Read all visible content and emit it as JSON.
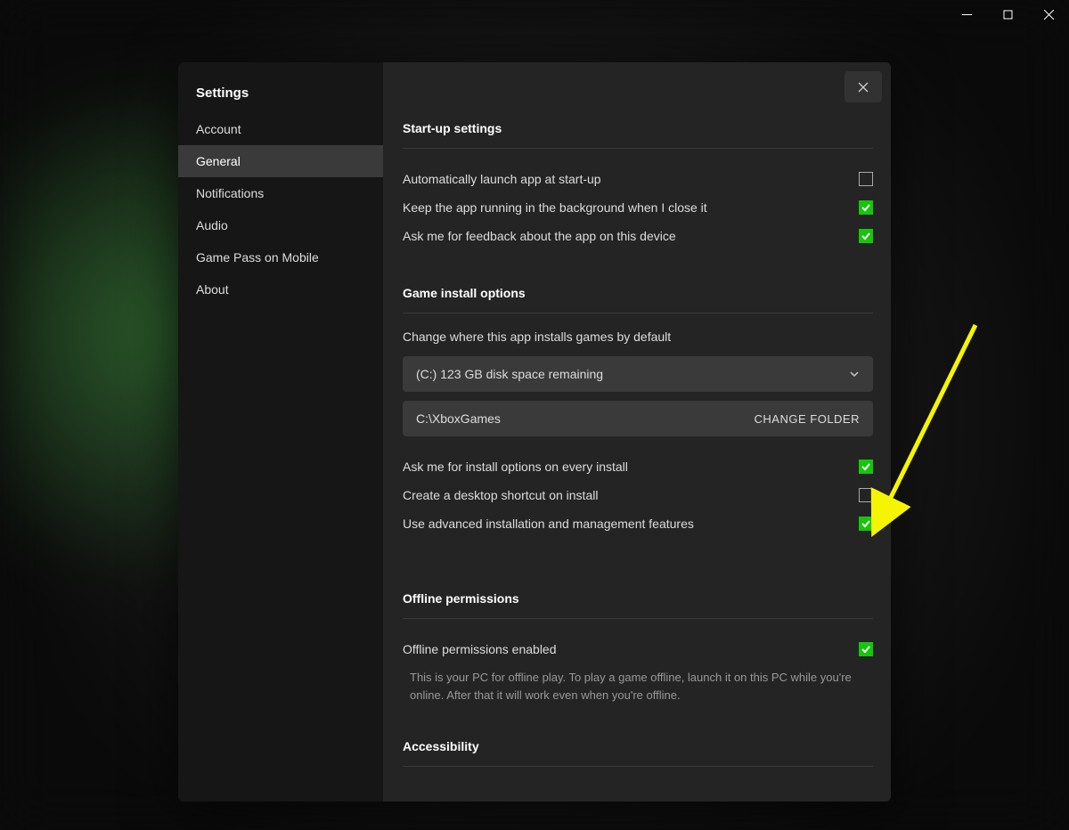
{
  "sidebar": {
    "title": "Settings",
    "items": [
      {
        "label": "Account"
      },
      {
        "label": "General"
      },
      {
        "label": "Notifications"
      },
      {
        "label": "Audio"
      },
      {
        "label": "Game Pass on Mobile"
      },
      {
        "label": "About"
      }
    ],
    "active_index": 1
  },
  "sections": {
    "startup": {
      "title": "Start-up settings",
      "items": [
        {
          "label": "Automatically launch app at start-up",
          "checked": false
        },
        {
          "label": "Keep the app running in the background when I close it",
          "checked": true
        },
        {
          "label": "Ask me for feedback about the app on this device",
          "checked": true
        }
      ]
    },
    "install": {
      "title": "Game install options",
      "where_label": "Change where this app installs games by default",
      "drive_selected": "(C:) 123 GB disk space remaining",
      "folder_path": "C:\\XboxGames",
      "change_folder_label": "CHANGE FOLDER",
      "items": [
        {
          "label": "Ask me for install options on every install",
          "checked": true
        },
        {
          "label": "Create a desktop shortcut on install",
          "checked": false
        },
        {
          "label": "Use advanced installation and management features",
          "checked": true
        }
      ]
    },
    "offline": {
      "title": "Offline permissions",
      "item": {
        "label": "Offline permissions enabled",
        "checked": true
      },
      "help": "This is your PC for offline play. To play a game offline, launch it on this PC while you're online. After that it will work even when you're offline."
    },
    "accessibility": {
      "title": "Accessibility"
    }
  }
}
